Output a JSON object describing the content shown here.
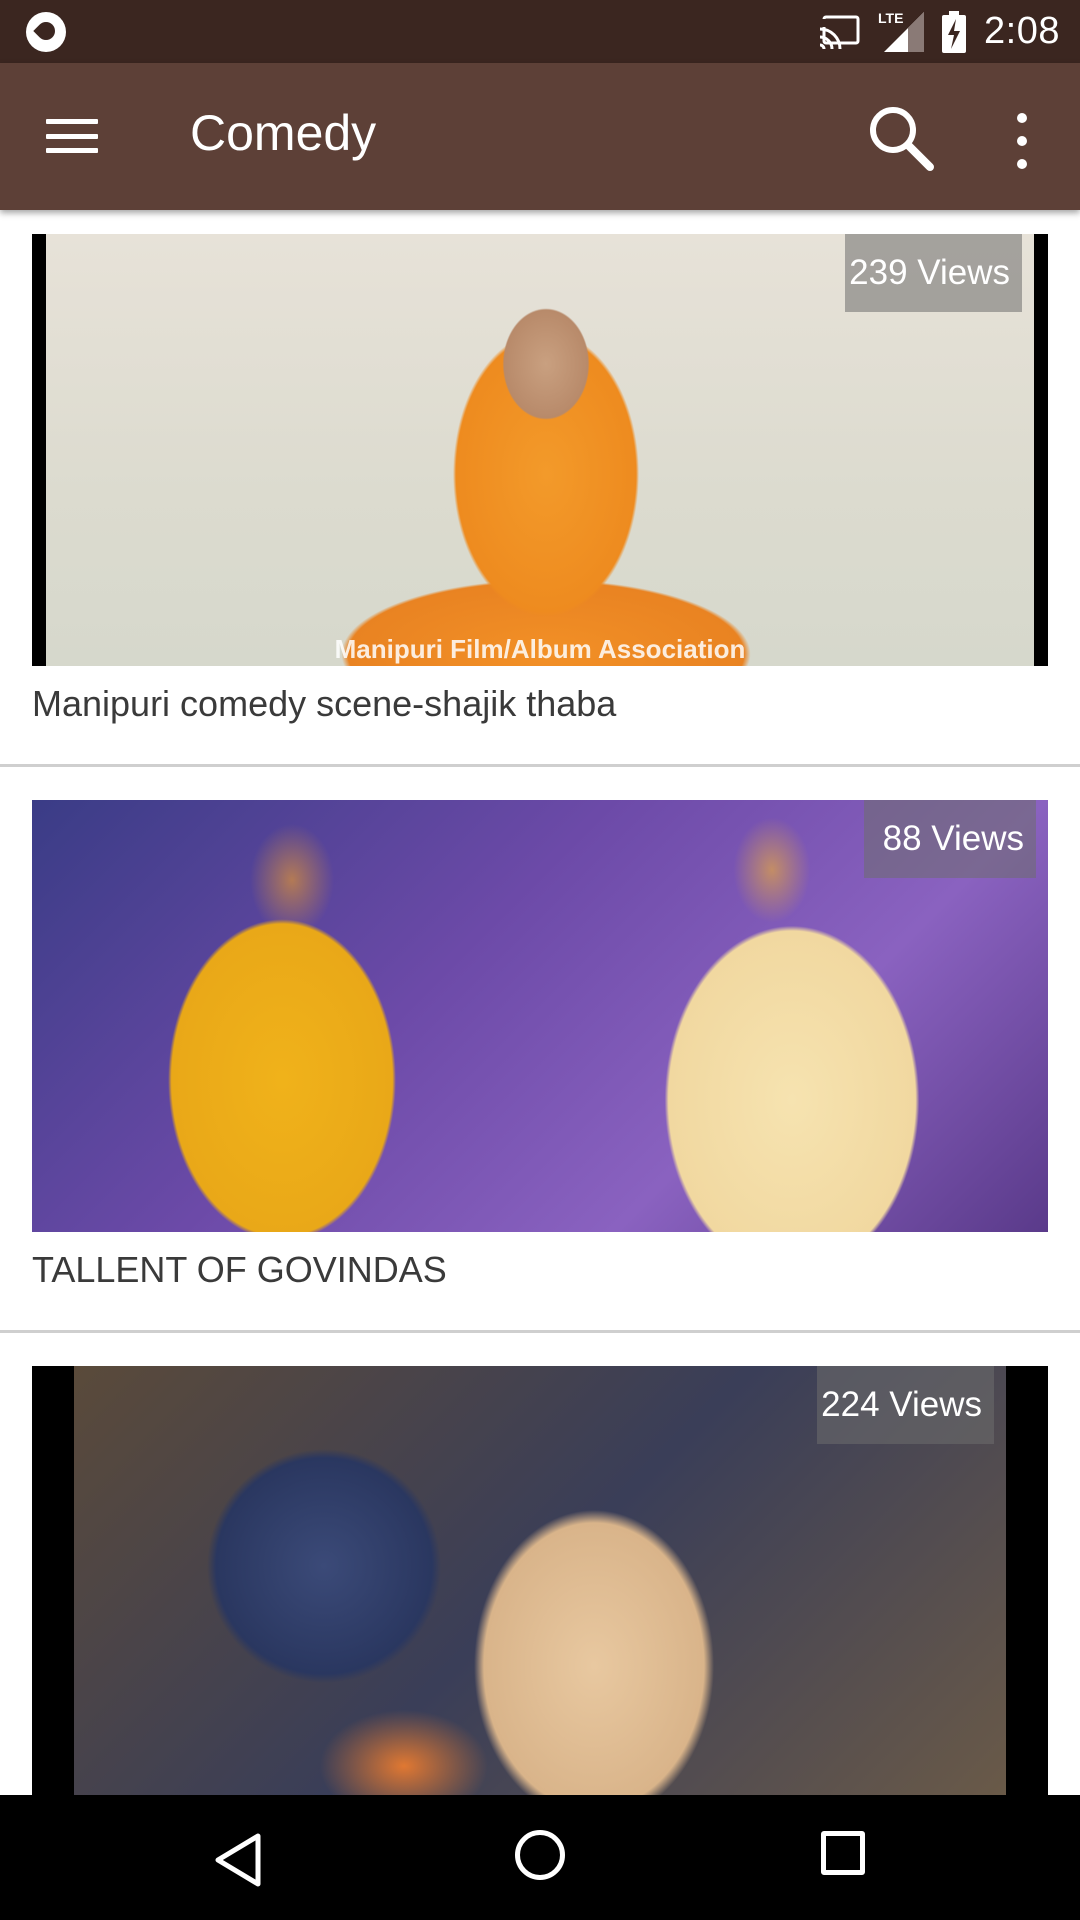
{
  "status_bar": {
    "time": "2:08",
    "network_label": "LTE",
    "icons": [
      "app-notification-icon",
      "cast-icon",
      "lte-signal-icon",
      "battery-charging-icon"
    ]
  },
  "toolbar": {
    "title": "Comedy",
    "menu_icon": "hamburger-menu-icon",
    "search_icon": "search-icon",
    "overflow_icon": "more-vert-icon",
    "background_color": "#5d4037"
  },
  "videos": [
    {
      "title": "Manipuri comedy scene-shajik thaba",
      "views": "239 Views",
      "thumbnail_caption": "Manipuri Film/Album Association"
    },
    {
      "title": "TALLENT OF GOVINDAS",
      "views": "88 Views"
    },
    {
      "title": "",
      "views": "224 Views"
    }
  ],
  "nav_bar": {
    "icons": [
      "back-icon",
      "home-icon",
      "recents-icon"
    ]
  }
}
